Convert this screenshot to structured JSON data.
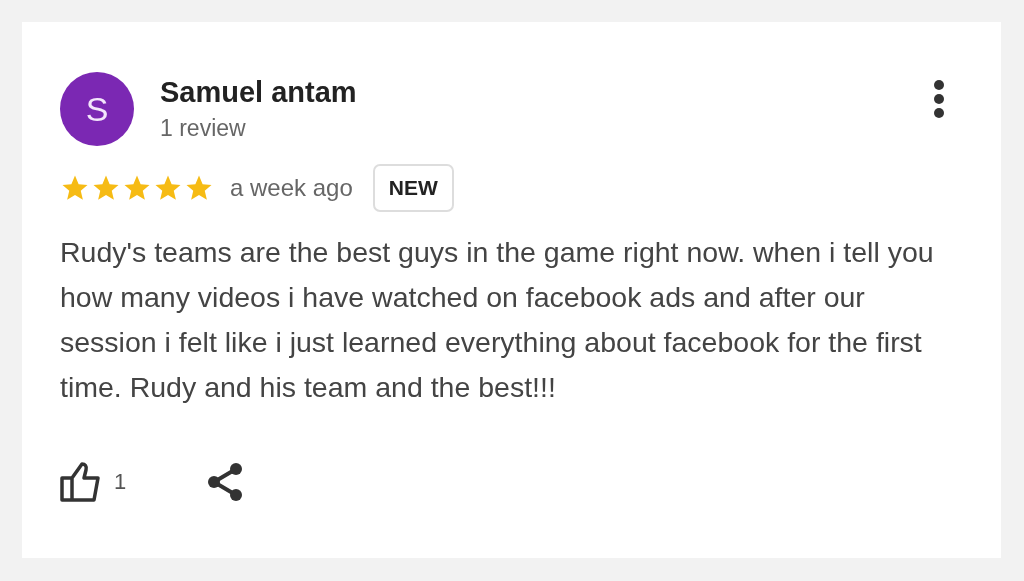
{
  "review": {
    "avatar_letter": "S",
    "author": "Samuel antam",
    "author_meta": "1 review",
    "stars": 5,
    "time": "a week ago",
    "badge": "NEW",
    "text": "Rudy's teams are the best guys in the game right now. when i tell you how many videos i have watched on facebook ads and after our session i felt like i just learned everything about facebook for the first time. Rudy and his team and the best!!!",
    "likes": "1"
  }
}
